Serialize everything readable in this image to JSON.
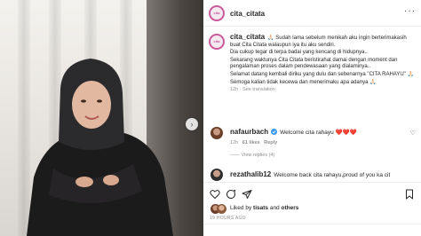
{
  "post": {
    "username": "cita_citata",
    "avatar_logo": "cita"
  },
  "caption": {
    "username": "cita_citata",
    "lines": [
      "🙏🏻 Sudah lama sebelum menikah aku ingin berterimakasih buat Cita Citata walaupun iya itu aku sendiri.",
      "Dia cukup tegar di terpa badai yang kencang di hidupnya..",
      "Sekarang waktunya Cita Citata beristirahat damai dengan moment dan pengalaman proses dalam pendewasaan yang dialaminya..",
      "Selamat datang kembali diriku yang dulu dan sebenarnya \"CITA RAHAYU\" 🙏🏻",
      "Semoga kalian tidak kecewa dan menerimaku apa adanya 🙏🏻"
    ],
    "time": "12h",
    "see_translation": "See translation"
  },
  "comments": [
    {
      "username": "nafaurbach",
      "verified": true,
      "text": "Welcome cita rahayu ❤️❤️❤️",
      "time": "12h",
      "likes": "61 likes",
      "reply": "Reply",
      "view_replies": "View replies (4)"
    },
    {
      "username": "rezathalib12",
      "text": "Welcome back cita rahayu,proud of you ka cit"
    }
  ],
  "likes": {
    "prefix": "Liked by",
    "user1": "tisats",
    "and": "and",
    "others": "others"
  },
  "time_ago": "19 HOURS AGO",
  "colors": {
    "brand": "#c75b9b",
    "verified": "#3897f0",
    "heart": "#ed4956"
  },
  "icons": [
    "more-icon",
    "heart-icon",
    "comment-icon",
    "share-icon",
    "save-icon",
    "verified-icon",
    "chevron-right-icon"
  ]
}
